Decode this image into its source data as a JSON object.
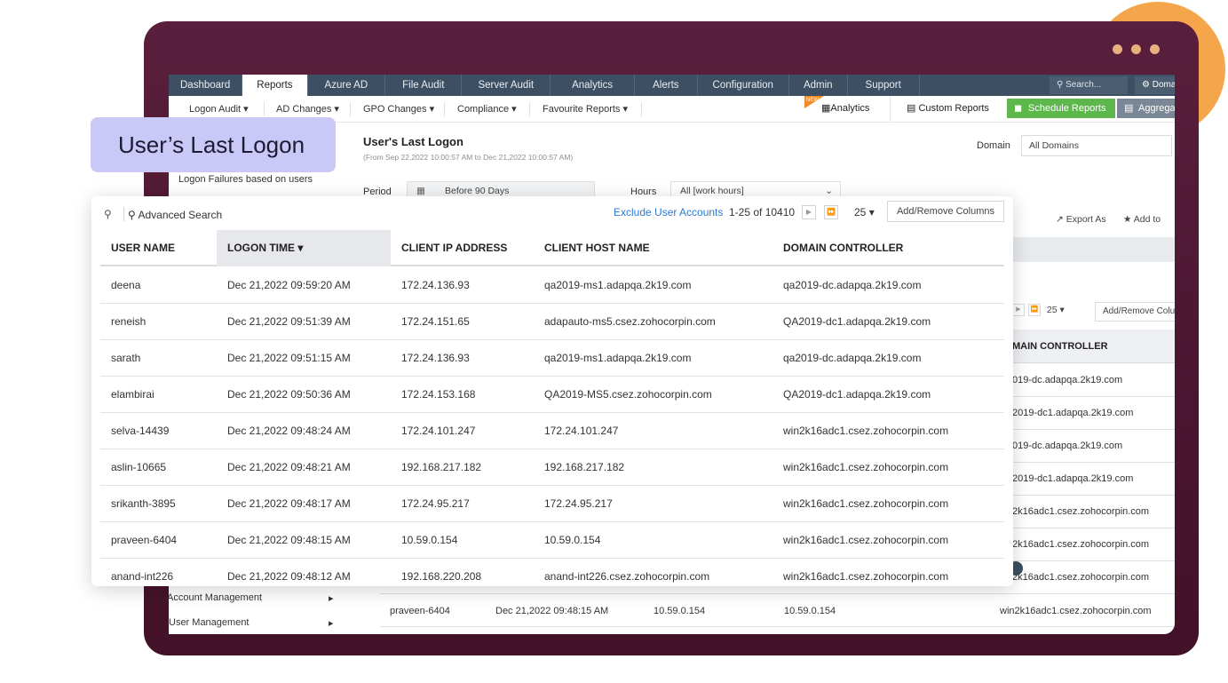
{
  "nav": {
    "tabs": [
      "Dashboard",
      "Reports",
      "Azure AD",
      "File Audit",
      "Server Audit",
      "Analytics",
      "Alerts",
      "Configuration",
      "Admin",
      "Support"
    ],
    "active_tab": "Reports",
    "search_placeholder": "Search...",
    "domain_button": "Doma"
  },
  "subnav": {
    "items": [
      "Logon Audit",
      "AD Changes",
      "GPO Changes",
      "Compliance",
      "Favourite Reports"
    ],
    "new_badge": "NEW",
    "analytics": "Analytics",
    "custom_reports": "Custom Reports",
    "schedule_reports": "Schedule Reports",
    "aggregate": "Aggrega"
  },
  "callout": {
    "label": "User’s Last Logon"
  },
  "left_menu": {
    "logon_failures": "Logon Failures based on users",
    "account_management": "Account Management",
    "user_management": "User Management"
  },
  "report": {
    "title": "User's Last Logon",
    "subtitle": "(From Sep 22,2022 10:00:57 AM to Dec 21,2022 10:00:57 AM)",
    "domain_label": "Domain",
    "domain_value": "All Domains",
    "period_label": "Period",
    "period_value": "Before 90 Days",
    "hours_label": "Hours",
    "hours_value": "All [work hours]",
    "export_as": "Export As",
    "add_to": "Add to"
  },
  "background_table": {
    "page_size": "25",
    "add_remove": "Add/Remove Colu",
    "dc_header": "MAIN CONTROLLER",
    "dc_values": [
      "019-dc.adapqa.2k19.com",
      "2019-dc1.adapqa.2k19.com",
      "019-dc.adapqa.2k19.com",
      "2019-dc1.adapqa.2k19.com",
      "2k16adc1.csez.zohocorpin.com",
      "2k16adc1.csez.zohocorpin.com",
      "2k16adc1.csez.zohocorpin.com"
    ],
    "last_row": {
      "user": "praveen-6404",
      "time": "Dec 21,2022 09:48:15 AM",
      "ip": "10.59.0.154",
      "host": "10.59.0.154",
      "dc": "win2k16adc1.csez.zohocorpin.com"
    }
  },
  "panel": {
    "advanced_search": "Advanced Search",
    "exclude_link": "Exclude User Accounts",
    "count": "1-25 of 10410",
    "page_size": "25",
    "add_remove": "Add/Remove Columns",
    "columns": [
      "USER NAME",
      "LOGON TIME",
      "CLIENT IP ADDRESS",
      "CLIENT HOST NAME",
      "DOMAIN CONTROLLER"
    ],
    "rows": [
      [
        "deena",
        "Dec 21,2022 09:59:20 AM",
        "172.24.136.93",
        "qa2019-ms1.adapqa.2k19.com",
        "qa2019-dc.adapqa.2k19.com"
      ],
      [
        "reneish",
        "Dec 21,2022 09:51:39 AM",
        "172.24.151.65",
        "adapauto-ms5.csez.zohocorpin.com",
        "QA2019-dc1.adapqa.2k19.com"
      ],
      [
        "sarath",
        "Dec 21,2022 09:51:15 AM",
        "172.24.136.93",
        "qa2019-ms1.adapqa.2k19.com",
        "qa2019-dc.adapqa.2k19.com"
      ],
      [
        "elambirai",
        "Dec 21,2022 09:50:36 AM",
        "172.24.153.168",
        "QA2019-MS5.csez.zohocorpin.com",
        "QA2019-dc1.adapqa.2k19.com"
      ],
      [
        "selva-14439",
        "Dec 21,2022 09:48:24 AM",
        "172.24.101.247",
        "172.24.101.247",
        "win2k16adc1.csez.zohocorpin.com"
      ],
      [
        "aslin-10665",
        "Dec 21,2022 09:48:21 AM",
        "192.168.217.182",
        "192.168.217.182",
        "win2k16adc1.csez.zohocorpin.com"
      ],
      [
        "srikanth-3895",
        "Dec 21,2022 09:48:17 AM",
        "172.24.95.217",
        "172.24.95.217",
        "win2k16adc1.csez.zohocorpin.com"
      ],
      [
        "praveen-6404",
        "Dec 21,2022 09:48:15 AM",
        "10.59.0.154",
        "10.59.0.154",
        "win2k16adc1.csez.zohocorpin.com"
      ],
      [
        "anand-int226",
        "Dec 21,2022 09:48:12 AM",
        "192.168.220.208",
        "anand-int226.csez.zohocorpin.com",
        "win2k16adc1.csez.zohocorpin.com"
      ]
    ]
  },
  "colors": {
    "frame": "#4a1530",
    "accent_orange": "#f5a54a",
    "callout_bg": "#cac8f7",
    "nav_bg": "#3d4f63",
    "schedule_green": "#5cb84a",
    "link_blue": "#2a7bd1"
  }
}
